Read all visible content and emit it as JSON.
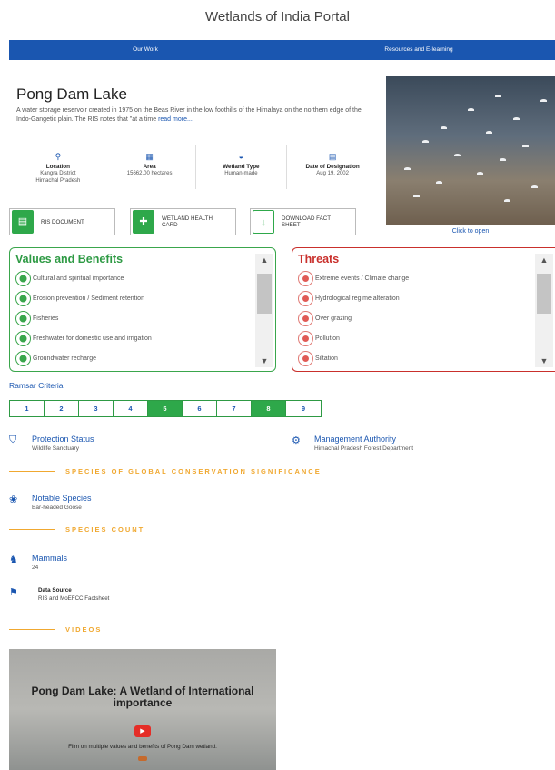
{
  "site": {
    "title": "Wetlands of India Portal"
  },
  "nav": {
    "items": [
      "Our Work",
      "Resources and E-learning"
    ]
  },
  "wetland": {
    "name": "Pong Dam Lake",
    "description": "A water storage reservoir created in 1975 on the Beas River in the low foothills of the Himalaya on the northern edge of the Indo-Gangetic plain. The RIS notes that \"at a time ",
    "read_more": "read more..."
  },
  "facts": [
    {
      "icon": "location-pin-icon",
      "glyph": "⚲",
      "label": "Location",
      "value1": "Kangra District",
      "value2": "Himachal Pradesh"
    },
    {
      "icon": "area-icon",
      "glyph": "▦",
      "label": "Area",
      "value1": "15662.00 hectares",
      "value2": ""
    },
    {
      "icon": "wetland-type-icon",
      "glyph": "◒",
      "label": "Wetland Type",
      "value1": "Human-made",
      "value2": ""
    },
    {
      "icon": "calendar-icon",
      "glyph": "▤",
      "label": "Date of Designation",
      "value1": "Aug 19, 2002",
      "value2": ""
    }
  ],
  "documents": {
    "ris": "RIS DOCUMENT",
    "health": "WETLAND HEALTH CARD",
    "factsheet": "DOWNLOAD FACT SHEET"
  },
  "photo": {
    "click_label": "Click to open"
  },
  "values": {
    "title": "Values and Benefits",
    "items": [
      "Cultural and spiritual importance",
      "Erosion prevention / Sediment retention",
      "Fisheries",
      "Freshwater for domestic use and irrigation",
      "Groundwater recharge"
    ]
  },
  "threats": {
    "title": "Threats",
    "items": [
      "Extreme events / Climate change",
      "Hydrological regime alteration",
      "Over grazing",
      "Pollution",
      "Siltation"
    ]
  },
  "ramsar": {
    "title": "Ramsar Criteria",
    "criteria": [
      "1",
      "2",
      "3",
      "4",
      "5",
      "6",
      "7",
      "8",
      "9"
    ],
    "met": [
      "5",
      "8"
    ]
  },
  "protection": {
    "title": "Protection Status",
    "value": "Wildlife Sanctuary"
  },
  "management": {
    "title": "Management Authority",
    "value": "Himachal Pradesh Forest Department"
  },
  "sections": {
    "global": "SPECIES OF GLOBAL CONSERVATION SIGNIFICANCE",
    "count": "SPECIES COUNT",
    "videos": "VIDEOS"
  },
  "notable": {
    "title": "Notable Species",
    "value": "Bar-headed Goose"
  },
  "mammals": {
    "title": "Mammals",
    "value": "24"
  },
  "data_source": {
    "title": "Data Source",
    "value": "RIS and MoEFCC Factsheet"
  },
  "video": {
    "title": "Pong Dam Lake: A Wetland of International importance",
    "subtitle": "Film on multiple values and benefits of Pong Dam wetland."
  }
}
